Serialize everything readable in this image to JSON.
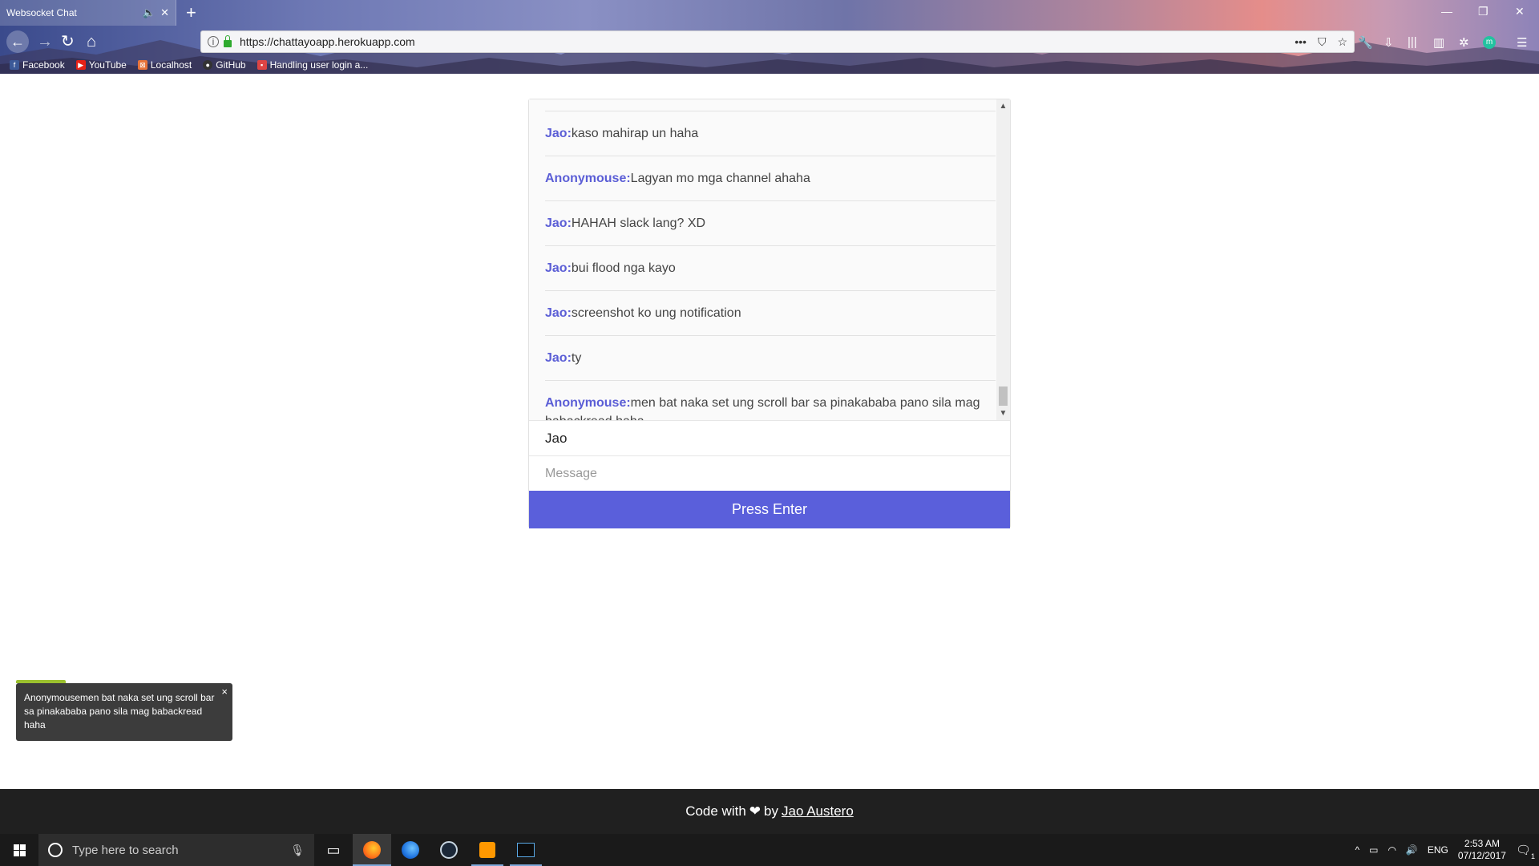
{
  "browser": {
    "tab_title": "Websocket Chat",
    "url": "https://chattayoapp.herokuapp.com",
    "bookmarks": [
      {
        "label": "Facebook",
        "icon": "facebook-icon",
        "color": "#3b5998"
      },
      {
        "label": "YouTube",
        "icon": "youtube-icon",
        "color": "#e62117"
      },
      {
        "label": "Localhost",
        "icon": "localhost-icon",
        "color": "#e8743b"
      },
      {
        "label": "GitHub",
        "icon": "github-icon",
        "color": "#333333"
      },
      {
        "label": "Handling user login a...",
        "icon": "page-icon",
        "color": "#d44"
      }
    ]
  },
  "chat": {
    "messages": [
      {
        "sender": "Jao:",
        "text": "kaso mahirap un haha"
      },
      {
        "sender": "Anonymouse:",
        "text": "Lagyan mo mga channel ahaha"
      },
      {
        "sender": "Jao:",
        "text": "HAHAH slack lang? XD"
      },
      {
        "sender": "Jao:",
        "text": "bui flood nga kayo"
      },
      {
        "sender": "Jao:",
        "text": "screenshot ko ung notification"
      },
      {
        "sender": "Jao:",
        "text": "ty"
      },
      {
        "sender": "Anonymouse:",
        "text": "men bat naka set ung scroll bar sa pinakababa pano sila mag babackread haha"
      }
    ],
    "name_value": "Jao",
    "message_placeholder": "Message",
    "button_label": "Press Enter",
    "accent_color": "#5a5fdb"
  },
  "notification": {
    "text": "Anonymousemen bat naka set ung scroll bar sa pinakababa pano sila mag babackread haha"
  },
  "footer": {
    "prefix": "Code with",
    "heart": "❤",
    "by": "by",
    "author": "Jao Austero"
  },
  "taskbar": {
    "search_placeholder": "Type here to search",
    "language": "ENG",
    "time": "2:53 AM",
    "date": "07/12/2017",
    "notification_count": "1"
  }
}
